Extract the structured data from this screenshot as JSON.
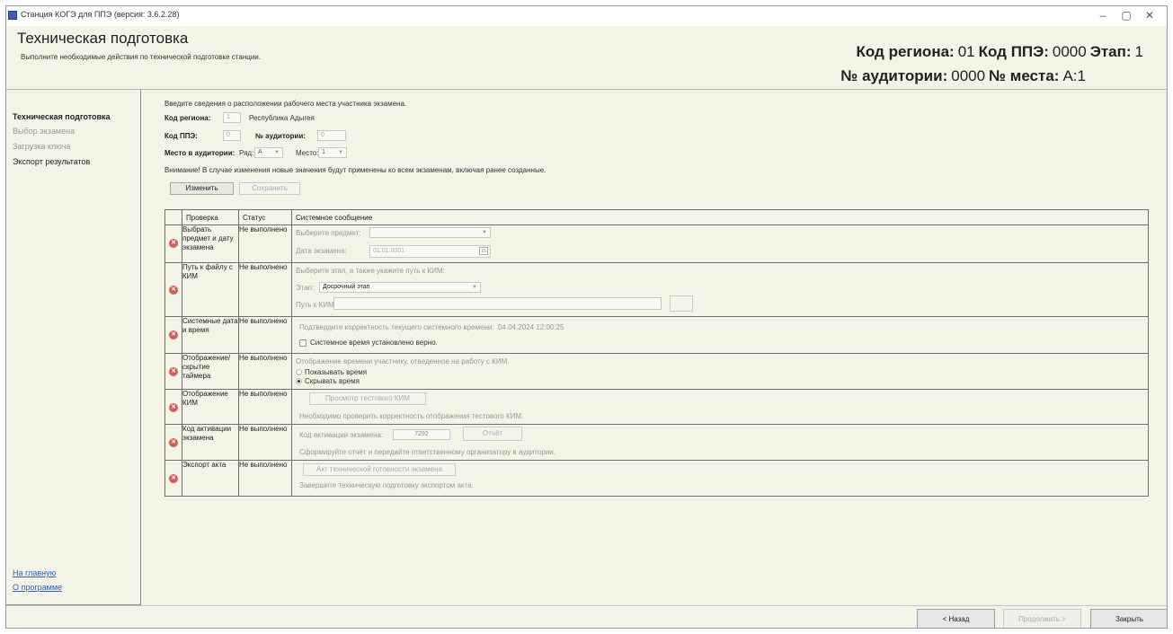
{
  "window": {
    "title": "Станция КОГЭ для ППЭ (версия: 3.6.2.28)",
    "controls": {
      "minimize": "–",
      "restore": "▢",
      "close": "✕"
    }
  },
  "header": {
    "title": "Техническая подготовка",
    "subtitle": "Выполните необходимые действия по технической подготовке станции.",
    "info_line1": {
      "region_label": "Код региона:",
      "region_value": "01",
      "ppe_label": "Код ППЭ:",
      "ppe_value": "0000",
      "stage_label": "Этап:",
      "stage_value": "1"
    },
    "info_line2": {
      "room_label": "№ аудитории:",
      "room_value": "0000",
      "seat_label": "№ места:",
      "seat_value": "А:1"
    }
  },
  "sidebar": {
    "items": [
      {
        "label": "Техническая подготовка",
        "state": "active"
      },
      {
        "label": "Выбор экзамена",
        "state": "disabled"
      },
      {
        "label": "Загрузка ключа",
        "state": "disabled"
      },
      {
        "label": "Экспорт результатов",
        "state": "normal"
      }
    ],
    "links": {
      "home": "На главную",
      "about": "О программе"
    }
  },
  "location_form": {
    "intro": "Введите сведения о расположении рабочего места участника экзамена.",
    "region_label": "Код региона:",
    "region_value": "1",
    "region_name": "Республика Адыгея",
    "ppe_label": "Код ППЭ:",
    "ppe_value": "0",
    "room_label": "№ аудитории:",
    "room_value": "0",
    "place_label": "Место в аудитории:",
    "row_label": "Ряд:",
    "row_value": "А",
    "seat_label": "Место:",
    "seat_value": "1",
    "warning": "Внимание! В случае изменения новые значения будут применены ко всем экзаменам, включая ранее созданные.",
    "edit_button": "Изменить",
    "save_button": "Сохранить"
  },
  "checks_table": {
    "headers": {
      "check": "Проверка",
      "status": "Статус",
      "message": "Системное сообщение"
    },
    "status_not_done": "Не выполнено",
    "rows": {
      "subject": {
        "name": "Выбрать предмет и дату экзамена",
        "subject_label": "Выберите предмет:",
        "subject_value": "",
        "date_label": "Дата экзамена:",
        "date_value": "01.01.0001",
        "calendar_icon": "15"
      },
      "kim_path": {
        "name": "Путь к файлу с КИМ",
        "intro": "Выберите этап, а также укажите путь к КИМ:",
        "stage_label": "Этап:",
        "stage_value": "Досрочный этап",
        "path_label": "Путь к КИМ:",
        "path_value": "",
        "browse_label": ""
      },
      "sys_time": {
        "name": "Системные дата и время",
        "confirm_text": "Подтвердите корректность текущего системного времени:",
        "time_value": "04.04.2024 12:00:25",
        "checkbox_label": "Системное время установлено верно."
      },
      "timer": {
        "name": "Отображение/ скрытие таймера",
        "intro": "Отображение времени участнику, отведенное на работу с КИМ.",
        "show_label": "Показывать время",
        "hide_label": "Скрывать время"
      },
      "kim_display": {
        "name": "Отображение КИМ",
        "button": "Просмотр тестового КИМ",
        "note": "Необходимо проверить корректность отображения тестового КИМ."
      },
      "activation": {
        "name": "Код активации экзамена",
        "code_label": "Код активации экзамена:",
        "code_value": "7292",
        "report_button": "Отчёт",
        "note": "Сформируйте отчёт и передайте ответственному организатору в аудитории."
      },
      "export": {
        "name": "Экспорт акта",
        "button": "Акт технической готовности экзамена",
        "note": "Завершите техническую подготовку экспортом акта."
      }
    }
  },
  "footer": {
    "back": "< Назад",
    "continue": "Продолжить >",
    "close": "Закрыть"
  },
  "colors": {
    "background": "#f3f3e6",
    "error_icon": "#d85b55",
    "link": "#2b5fc4"
  }
}
